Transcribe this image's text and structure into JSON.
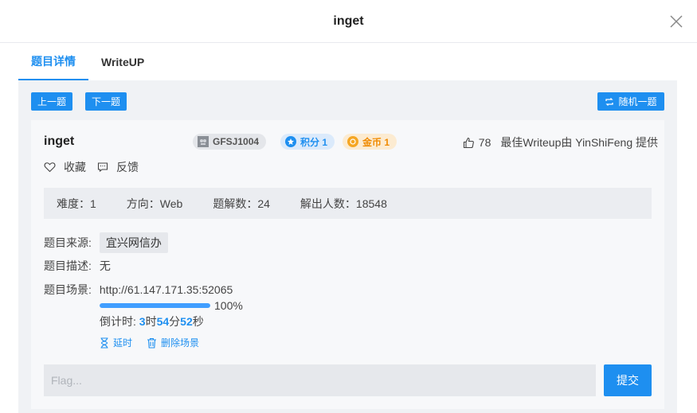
{
  "modal": {
    "title": "inget"
  },
  "tabs": [
    {
      "label": "题目详情",
      "active": true
    },
    {
      "label": "WriteUP",
      "active": false
    }
  ],
  "nav": {
    "prev_label": "上一题",
    "next_label": "下一题",
    "random_label": "随机一题"
  },
  "problem": {
    "title": "inget",
    "author_badge": "GFSJ1004",
    "score_badge": "积分 1",
    "coin_badge": "金币 1",
    "likes": "78",
    "best_writeup": "最佳Writeup由 YinShiFeng 提供",
    "favorite_label": "收藏",
    "feedback_label": "反馈"
  },
  "stats": {
    "difficulty": "难度：1",
    "direction": "方向：Web",
    "writeups": "题解数：24",
    "solvers": "解出人数：18548"
  },
  "details": {
    "source_label": "题目来源:",
    "source_value": "宜兴网信办",
    "desc_label": "题目描述:",
    "desc_value": "无",
    "scene_label": "题目场景:",
    "scene_url": "http://61.147.171.35:52065",
    "progress": 1.0,
    "progress_text": "100%",
    "countdown_prefix": "倒计时: ",
    "hours": "3",
    "hours_unit": "时",
    "minutes": "54",
    "minutes_unit": "分",
    "seconds": "52",
    "seconds_unit": "秒",
    "extend_label": "延时",
    "delete_label": "删除场景"
  },
  "flag": {
    "placeholder": "Flag...",
    "submit_label": "提交"
  },
  "colors": {
    "accent": "#1e8ff0",
    "coin": "#f5a623",
    "score": "#1e8ff0"
  },
  "icons": [
    "close-icon",
    "random-icon",
    "avatar-icon",
    "score-icon",
    "coin-icon",
    "thumbs-up-icon",
    "heart-icon",
    "feedback-icon",
    "hourglass-icon",
    "trash-icon"
  ]
}
